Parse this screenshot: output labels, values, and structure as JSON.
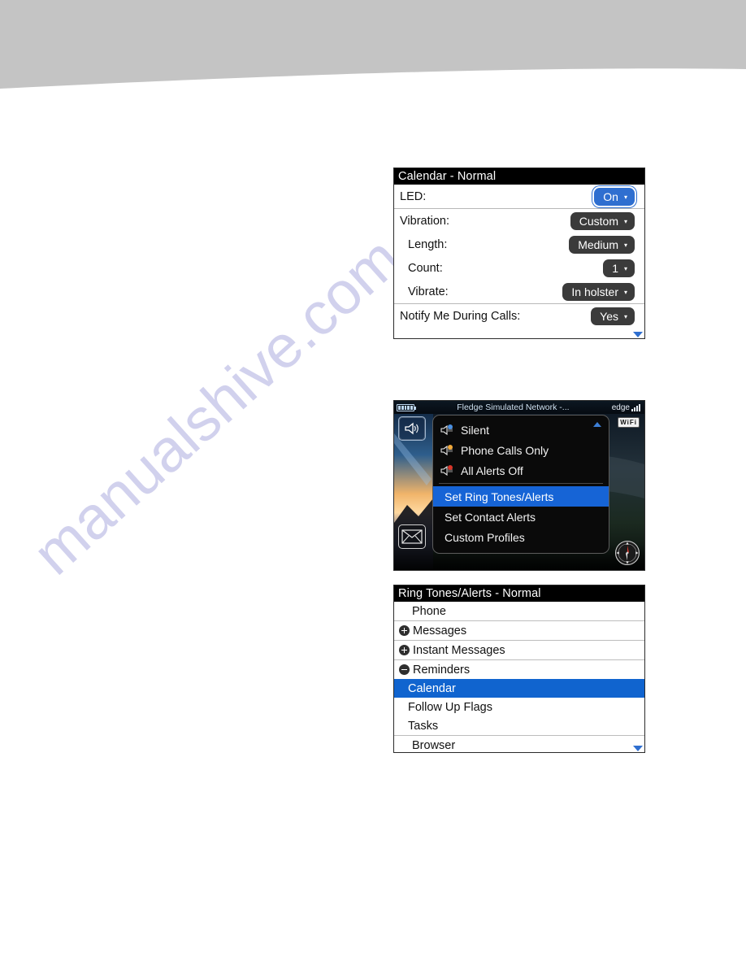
{
  "page": {
    "background_color": "#ffffff",
    "banner_color": "#c4c4c4",
    "watermark_text": "manualshive.com"
  },
  "panel_calendar": {
    "title": "Calendar - Normal",
    "rows": [
      {
        "label": "LED:",
        "value": "On",
        "indent": false,
        "selected": true
      },
      {
        "label": "Vibration:",
        "value": "Custom",
        "indent": false,
        "selected": false
      },
      {
        "label": "Length:",
        "value": "Medium",
        "indent": true,
        "selected": false
      },
      {
        "label": "Count:",
        "value": "1",
        "indent": true,
        "selected": false
      },
      {
        "label": "Vibrate:",
        "value": "In holster",
        "indent": true,
        "selected": false
      },
      {
        "label": "Notify Me During Calls:",
        "value": "Yes",
        "indent": false,
        "selected": false
      }
    ],
    "caret_glyph": "▾",
    "scroll_down_icon": "scroll-down-arrow-icon",
    "selected_color": "#2f6fd0",
    "dropdown_color": "#3b3b3b"
  },
  "panel_home": {
    "status_bar": {
      "network_name": "Fledge Simulated Network -...",
      "edge_label": "edge",
      "battery_icon": "battery-icon",
      "signal_icon": "signal-bars-icon"
    },
    "wallpaper_alt": "sunset-mountain-wallpaper",
    "left_icons": [
      {
        "name": "speaker-profile-icon",
        "glyph": "🔊"
      },
      {
        "name": "messages-envelope-icon",
        "glyph": "✉"
      }
    ],
    "wifi_badge": "WiFi",
    "compass_icon": "compass-icon",
    "menu": {
      "scroll_up_icon": "menu-scroll-up-arrow-icon",
      "items": [
        {
          "label": "Silent",
          "icon": "speaker-silent-icon",
          "badge_color": "#4a90e2",
          "highlight": false
        },
        {
          "label": "Phone Calls Only",
          "icon": "speaker-phone-only-icon",
          "badge_color": "#f2a93b",
          "highlight": false
        },
        {
          "label": "All Alerts Off",
          "icon": "speaker-muted-icon",
          "badge_color": "#d8362a",
          "highlight": false
        },
        {
          "label": "Set Ring Tones/Alerts",
          "icon": null,
          "badge_color": null,
          "highlight": true
        },
        {
          "label": "Set Contact Alerts",
          "icon": null,
          "badge_color": null,
          "highlight": false
        },
        {
          "label": "Custom Profiles",
          "icon": null,
          "badge_color": null,
          "highlight": false
        }
      ],
      "highlight_color": "#1664d6"
    }
  },
  "panel_ringtones": {
    "title": "Ring Tones/Alerts - Normal",
    "rows": [
      {
        "label": "Phone",
        "marker": "none",
        "level": "lead",
        "highlight": false
      },
      {
        "label": "Messages",
        "marker": "plus",
        "level": "top",
        "highlight": false
      },
      {
        "label": "Instant Messages",
        "marker": "plus",
        "level": "top",
        "highlight": false
      },
      {
        "label": "Reminders",
        "marker": "minus",
        "level": "top",
        "highlight": false
      },
      {
        "label": "Calendar",
        "marker": "none",
        "level": "child",
        "highlight": true
      },
      {
        "label": "Follow Up Flags",
        "marker": "none",
        "level": "child",
        "highlight": false
      },
      {
        "label": "Tasks",
        "marker": "none",
        "level": "child",
        "highlight": false
      },
      {
        "label": "Browser",
        "marker": "none",
        "level": "lead",
        "highlight": false
      }
    ],
    "scroll_down_icon": "scroll-down-arrow-icon",
    "highlight_color": "#1064cf"
  }
}
